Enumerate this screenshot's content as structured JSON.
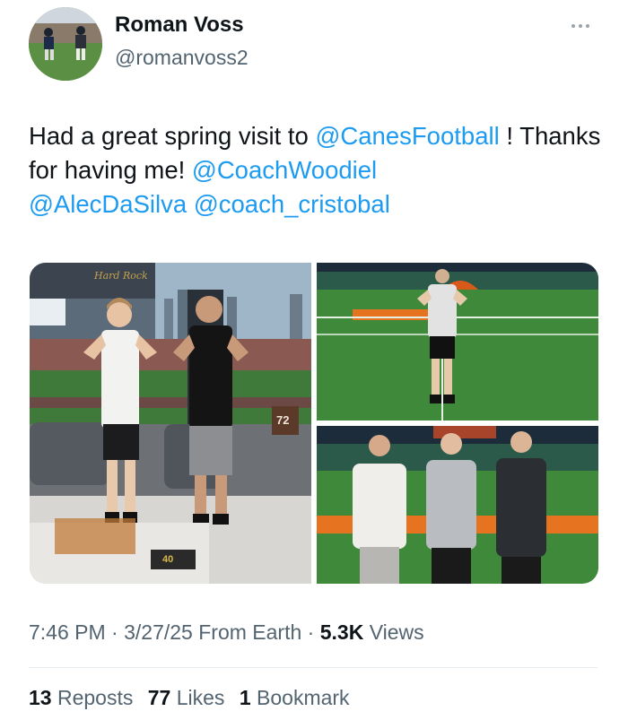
{
  "author": {
    "name": "Roman Voss",
    "handle": "@romanvoss2",
    "avatar_icon": "football-players-avatar"
  },
  "tweet": {
    "text_1": "Had a great spring visit to ",
    "mention_1": "@CanesFootball",
    "text_2": " ! Thanks for having me! ",
    "mention_2": "@CoachWoodiel",
    "mention_3": "@AlecDaSilva",
    "text_3": " ",
    "mention_4": "@coach_cristobal"
  },
  "media": {
    "sign_text": "Hard Rock",
    "jersey_number": "72",
    "desk_plaque": "40"
  },
  "meta": {
    "time": "7:46 PM",
    "sep1": " · ",
    "date": "3/27/25",
    "source": " From Earth",
    "sep2": " · ",
    "views_count": "5.3K",
    "views_label": " Views"
  },
  "stats": {
    "reposts_count": "13",
    "reposts_label": " Reposts",
    "likes_count": "77",
    "likes_label": " Likes",
    "bookmarks_count": "1",
    "bookmarks_label": " Bookmark"
  },
  "colors": {
    "link": "#1d9bf0",
    "muted": "#536471",
    "text": "#0f1419",
    "turf": "#3f8a3a",
    "canes_orange": "#e5731f"
  }
}
